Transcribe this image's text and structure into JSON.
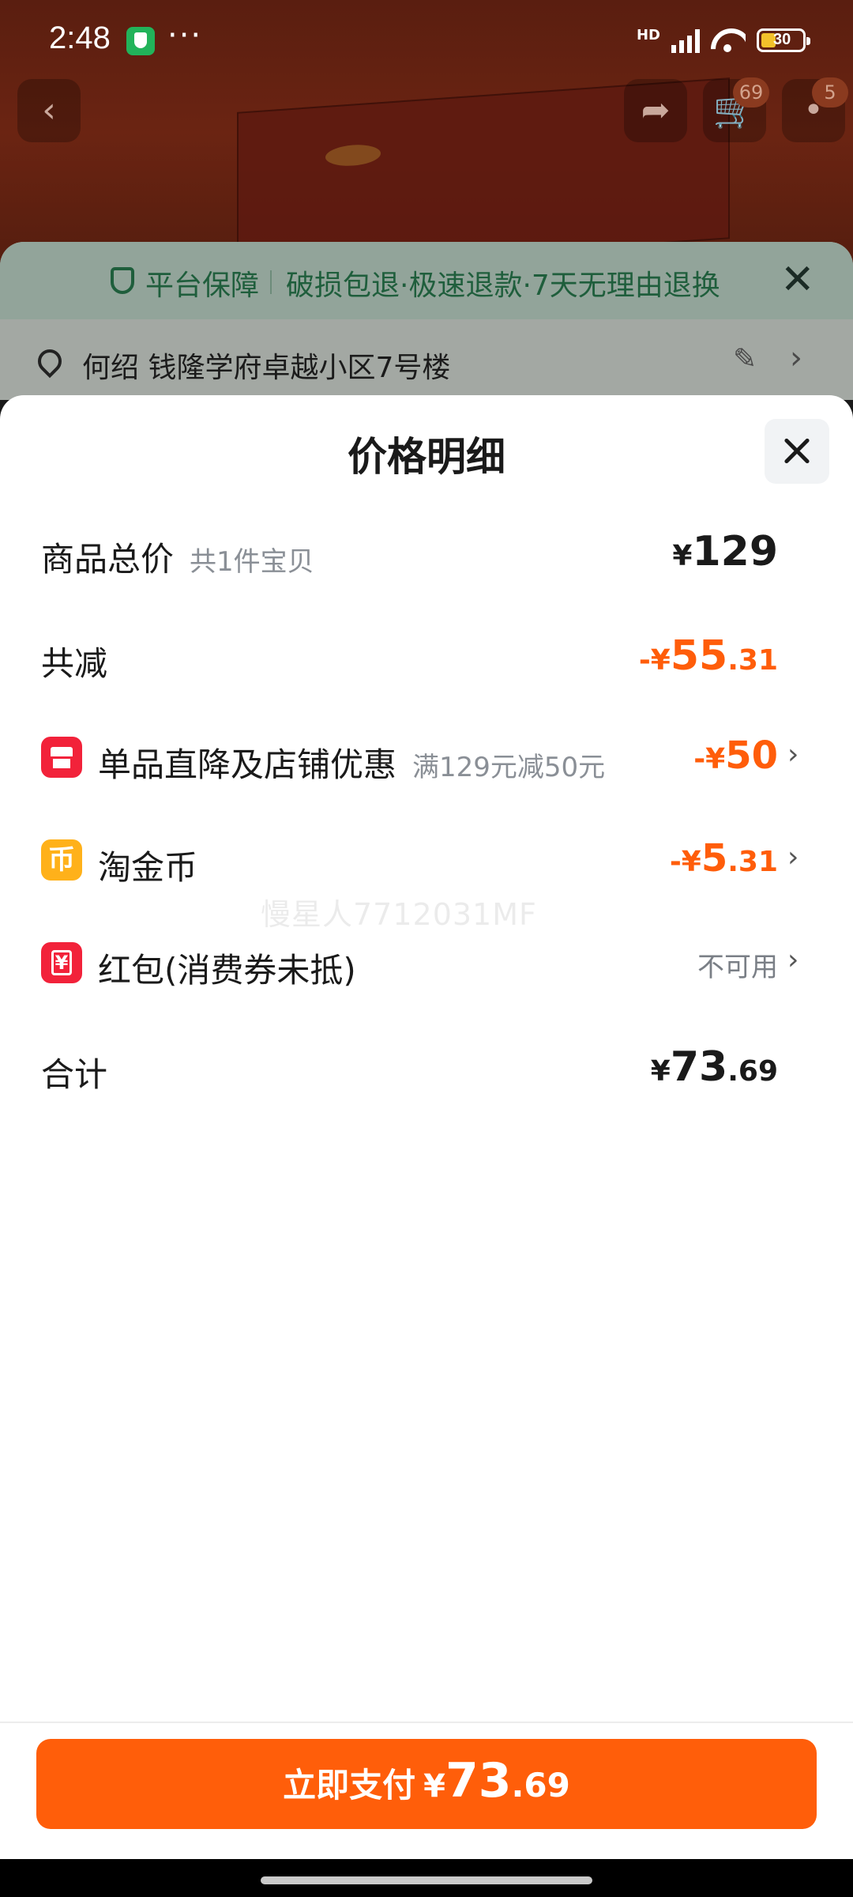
{
  "status_bar": {
    "time": "2:48",
    "dots": "···",
    "network": "HD",
    "battery": "30"
  },
  "top_nav": {
    "cart_badge": "69",
    "more_badge": "5"
  },
  "guarantee": {
    "title": "平台保障",
    "text": "破损包退·极速退款·7天无理由退换"
  },
  "address": {
    "text": "何绍  钱隆学府卓越小区7号楼"
  },
  "sheet": {
    "title": "价格明细",
    "rows": {
      "total": {
        "label": "商品总价",
        "sub": "共1件宝贝",
        "currency": "¥",
        "int": "129",
        "dec": ""
      },
      "discount": {
        "label": "共减",
        "sign": "-¥",
        "int": "55",
        "dec": ".31"
      },
      "store": {
        "label": "单品直降及店铺优惠",
        "sub": "满129元减50元",
        "sign": "-¥",
        "int": "50",
        "dec": ""
      },
      "coins": {
        "label": "淘金币",
        "icon_char": "币",
        "sign": "-¥",
        "int": "5",
        "dec": ".31"
      },
      "redpacket": {
        "label": "红包(消费券未抵)",
        "icon_char": "¥",
        "value": "不可用"
      },
      "sum": {
        "label": "合计",
        "currency": "¥",
        "int": "73",
        "dec": ".69"
      }
    },
    "watermark": "慢星人7712031MF"
  },
  "pay": {
    "label": "立即支付",
    "currency": "¥",
    "int": "73",
    "dec": ".69"
  },
  "colors": {
    "accent_orange": "#ff5e0a",
    "guarantee_green": "#1f5e3c"
  },
  "icons": [
    "back-icon",
    "share-icon",
    "cart-icon",
    "more-icon",
    "shield-icon",
    "location-icon",
    "edit-icon",
    "chevron-right-icon",
    "close-icon",
    "store-icon",
    "coin-icon",
    "red-packet-icon"
  ]
}
